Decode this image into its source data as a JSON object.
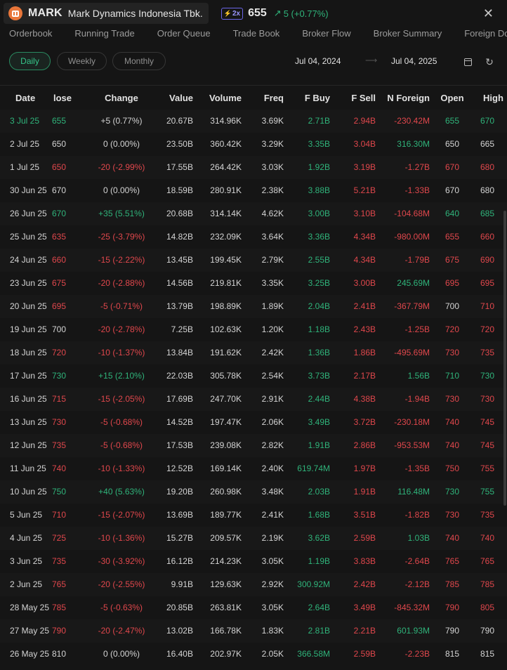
{
  "header": {
    "ticker": "MARK",
    "company": "Mark Dynamics Indonesia Tbk.",
    "badge": "2x",
    "price": "655",
    "change": "5 (+0.77%)",
    "close_icon": "close-icon"
  },
  "tabs": [
    "Orderbook",
    "Running Trade",
    "Order Queue",
    "Trade Book",
    "Broker Flow",
    "Broker Summary",
    "Foreign Domestic"
  ],
  "controls": {
    "periods": [
      "Daily",
      "Weekly",
      "Monthly"
    ],
    "active_period": "Daily",
    "date_from": "Jul 04, 2024",
    "date_to": "Jul 04, 2025"
  },
  "columns": [
    "Date",
    "lose",
    "Change",
    "Value",
    "Volume",
    "Freq",
    "F Buy",
    "F Sell",
    "N Foreign",
    "Open",
    "High"
  ],
  "rows": [
    [
      "3 Jul 25",
      "655",
      "+5 (0.77%)",
      "20.67B",
      "314.96K",
      "3.69K",
      "2.71B",
      "2.94B",
      "-230.42M",
      "655",
      "670"
    ],
    [
      "2 Jul 25",
      "650",
      "0 (0.00%)",
      "23.50B",
      "360.42K",
      "3.29K",
      "3.35B",
      "3.04B",
      "316.30M",
      "650",
      "665"
    ],
    [
      "1 Jul 25",
      "650",
      "-20 (-2.99%)",
      "17.55B",
      "264.42K",
      "3.03K",
      "1.92B",
      "3.19B",
      "-1.27B",
      "670",
      "680"
    ],
    [
      "30 Jun 25",
      "670",
      "0 (0.00%)",
      "18.59B",
      "280.91K",
      "2.38K",
      "3.88B",
      "5.21B",
      "-1.33B",
      "670",
      "680"
    ],
    [
      "26 Jun 25",
      "670",
      "+35 (5.51%)",
      "20.68B",
      "314.14K",
      "4.62K",
      "3.00B",
      "3.10B",
      "-104.68M",
      "640",
      "685"
    ],
    [
      "25 Jun 25",
      "635",
      "-25 (-3.79%)",
      "14.82B",
      "232.09K",
      "3.64K",
      "3.36B",
      "4.34B",
      "-980.00M",
      "655",
      "660"
    ],
    [
      "24 Jun 25",
      "660",
      "-15 (-2.22%)",
      "13.45B",
      "199.45K",
      "2.79K",
      "2.55B",
      "4.34B",
      "-1.79B",
      "675",
      "690"
    ],
    [
      "23 Jun 25",
      "675",
      "-20 (-2.88%)",
      "14.56B",
      "219.81K",
      "3.35K",
      "3.25B",
      "3.00B",
      "245.69M",
      "695",
      "695"
    ],
    [
      "20 Jun 25",
      "695",
      "-5 (-0.71%)",
      "13.79B",
      "198.89K",
      "1.89K",
      "2.04B",
      "2.41B",
      "-367.79M",
      "700",
      "710"
    ],
    [
      "19 Jun 25",
      "700",
      "-20 (-2.78%)",
      "7.25B",
      "102.63K",
      "1.20K",
      "1.18B",
      "2.43B",
      "-1.25B",
      "720",
      "720"
    ],
    [
      "18 Jun 25",
      "720",
      "-10 (-1.37%)",
      "13.84B",
      "191.62K",
      "2.42K",
      "1.36B",
      "1.86B",
      "-495.69M",
      "730",
      "735"
    ],
    [
      "17 Jun 25",
      "730",
      "+15 (2.10%)",
      "22.03B",
      "305.78K",
      "2.54K",
      "3.73B",
      "2.17B",
      "1.56B",
      "710",
      "730"
    ],
    [
      "16 Jun 25",
      "715",
      "-15 (-2.05%)",
      "17.69B",
      "247.70K",
      "2.91K",
      "2.44B",
      "4.38B",
      "-1.94B",
      "730",
      "730"
    ],
    [
      "13 Jun 25",
      "730",
      "-5 (-0.68%)",
      "14.52B",
      "197.47K",
      "2.06K",
      "3.49B",
      "3.72B",
      "-230.18M",
      "740",
      "745"
    ],
    [
      "12 Jun 25",
      "735",
      "-5 (-0.68%)",
      "17.53B",
      "239.08K",
      "2.82K",
      "1.91B",
      "2.86B",
      "-953.53M",
      "740",
      "745"
    ],
    [
      "11 Jun 25",
      "740",
      "-10 (-1.33%)",
      "12.52B",
      "169.14K",
      "2.40K",
      "619.74M",
      "1.97B",
      "-1.35B",
      "750",
      "755"
    ],
    [
      "10 Jun 25",
      "750",
      "+40 (5.63%)",
      "19.20B",
      "260.98K",
      "3.48K",
      "2.03B",
      "1.91B",
      "116.48M",
      "730",
      "755"
    ],
    [
      "5 Jun 25",
      "710",
      "-15 (-2.07%)",
      "13.69B",
      "189.77K",
      "2.41K",
      "1.68B",
      "3.51B",
      "-1.82B",
      "730",
      "735"
    ],
    [
      "4 Jun 25",
      "725",
      "-10 (-1.36%)",
      "15.27B",
      "209.57K",
      "2.19K",
      "3.62B",
      "2.59B",
      "1.03B",
      "740",
      "740"
    ],
    [
      "3 Jun 25",
      "735",
      "-30 (-3.92%)",
      "16.12B",
      "214.23K",
      "3.05K",
      "1.19B",
      "3.83B",
      "-2.64B",
      "765",
      "765"
    ],
    [
      "2 Jun 25",
      "765",
      "-20 (-2.55%)",
      "9.91B",
      "129.63K",
      "2.92K",
      "300.92M",
      "2.42B",
      "-2.12B",
      "785",
      "785"
    ],
    [
      "28 May 25",
      "785",
      "-5 (-0.63%)",
      "20.85B",
      "263.81K",
      "3.05K",
      "2.64B",
      "3.49B",
      "-845.32M",
      "790",
      "805"
    ],
    [
      "27 May 25",
      "790",
      "-20 (-2.47%)",
      "13.02B",
      "166.78K",
      "1.83K",
      "2.81B",
      "2.21B",
      "601.93M",
      "790",
      "790"
    ],
    [
      "26 May 25",
      "810",
      "0 (0.00%)",
      "16.40B",
      "202.97K",
      "2.05K",
      "366.58M",
      "2.59B",
      "-2.23B",
      "815",
      "815"
    ]
  ],
  "row_colors": [
    [
      "up",
      "up",
      "flat",
      "flat",
      "flat",
      "flat",
      "up",
      "down",
      "down",
      "up",
      "up"
    ],
    [
      "flat",
      "flat",
      "flat",
      "flat",
      "flat",
      "flat",
      "up",
      "down",
      "up",
      "flat",
      "flat"
    ],
    [
      "flat",
      "down",
      "down",
      "flat",
      "flat",
      "flat",
      "up",
      "down",
      "down",
      "down",
      "down"
    ],
    [
      "flat",
      "flat",
      "flat",
      "flat",
      "flat",
      "flat",
      "up",
      "down",
      "down",
      "flat",
      "flat"
    ],
    [
      "flat",
      "up",
      "up",
      "flat",
      "flat",
      "flat",
      "up",
      "down",
      "down",
      "up",
      "up"
    ],
    [
      "flat",
      "down",
      "down",
      "flat",
      "flat",
      "flat",
      "up",
      "down",
      "down",
      "down",
      "down"
    ],
    [
      "flat",
      "down",
      "down",
      "flat",
      "flat",
      "flat",
      "up",
      "down",
      "down",
      "down",
      "down"
    ],
    [
      "flat",
      "down",
      "down",
      "flat",
      "flat",
      "flat",
      "up",
      "down",
      "up",
      "down",
      "down"
    ],
    [
      "flat",
      "down",
      "down",
      "flat",
      "flat",
      "flat",
      "up",
      "down",
      "down",
      "flat",
      "down"
    ],
    [
      "flat",
      "flat",
      "down",
      "flat",
      "flat",
      "flat",
      "up",
      "down",
      "down",
      "down",
      "down"
    ],
    [
      "flat",
      "down",
      "down",
      "flat",
      "flat",
      "flat",
      "up",
      "down",
      "down",
      "down",
      "down"
    ],
    [
      "flat",
      "up",
      "up",
      "flat",
      "flat",
      "flat",
      "up",
      "down",
      "up",
      "up",
      "up"
    ],
    [
      "flat",
      "down",
      "down",
      "flat",
      "flat",
      "flat",
      "up",
      "down",
      "down",
      "down",
      "down"
    ],
    [
      "flat",
      "down",
      "down",
      "flat",
      "flat",
      "flat",
      "up",
      "down",
      "down",
      "down",
      "down"
    ],
    [
      "flat",
      "down",
      "down",
      "flat",
      "flat",
      "flat",
      "up",
      "down",
      "down",
      "down",
      "down"
    ],
    [
      "flat",
      "down",
      "down",
      "flat",
      "flat",
      "flat",
      "up",
      "down",
      "down",
      "down",
      "down"
    ],
    [
      "flat",
      "up",
      "up",
      "flat",
      "flat",
      "flat",
      "up",
      "down",
      "up",
      "up",
      "up"
    ],
    [
      "flat",
      "down",
      "down",
      "flat",
      "flat",
      "flat",
      "up",
      "down",
      "down",
      "down",
      "down"
    ],
    [
      "flat",
      "down",
      "down",
      "flat",
      "flat",
      "flat",
      "up",
      "down",
      "up",
      "down",
      "down"
    ],
    [
      "flat",
      "down",
      "down",
      "flat",
      "flat",
      "flat",
      "up",
      "down",
      "down",
      "down",
      "down"
    ],
    [
      "flat",
      "down",
      "down",
      "flat",
      "flat",
      "flat",
      "up",
      "down",
      "down",
      "down",
      "down"
    ],
    [
      "flat",
      "down",
      "down",
      "flat",
      "flat",
      "flat",
      "up",
      "down",
      "down",
      "down",
      "down"
    ],
    [
      "flat",
      "down",
      "down",
      "flat",
      "flat",
      "flat",
      "up",
      "down",
      "up",
      "flat",
      "flat"
    ],
    [
      "flat",
      "flat",
      "flat",
      "flat",
      "flat",
      "flat",
      "up",
      "down",
      "down",
      "flat",
      "flat"
    ]
  ],
  "colors": {
    "up": "#2fb37a",
    "down": "#e0474c",
    "accent": "#35c489",
    "badge": "#9a96ff",
    "logo": "#e8763a"
  }
}
